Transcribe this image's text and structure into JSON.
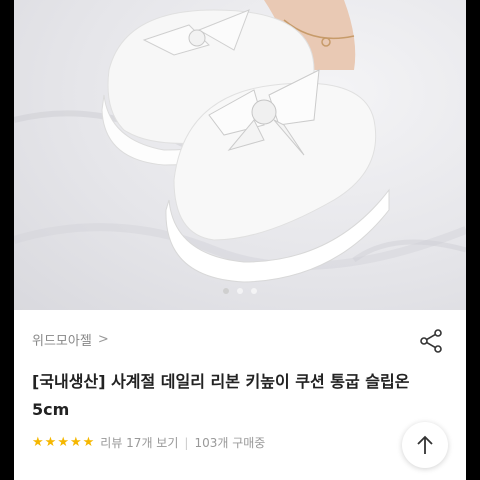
{
  "product": {
    "brand": "위드모아젤",
    "title": "[국내생산] 사계절 데일리 리본 키높이 쿠션 통굽 슬립온 5cm",
    "rating_stars": 5,
    "review_label": "리뷰 17개 보기",
    "sold_label": "103개 구매중"
  },
  "gallery": {
    "dot_count": 3,
    "active_index": 0
  },
  "icons": {
    "share": "share-icon",
    "brand_arrow": "chevron-right-icon",
    "scroll_top": "arrow-up-icon",
    "star": "star-icon"
  },
  "colors": {
    "star": "#f5b700",
    "muted_text": "#888888"
  },
  "symbols": {
    "chevron": ">",
    "star": "★",
    "separator": "|"
  }
}
